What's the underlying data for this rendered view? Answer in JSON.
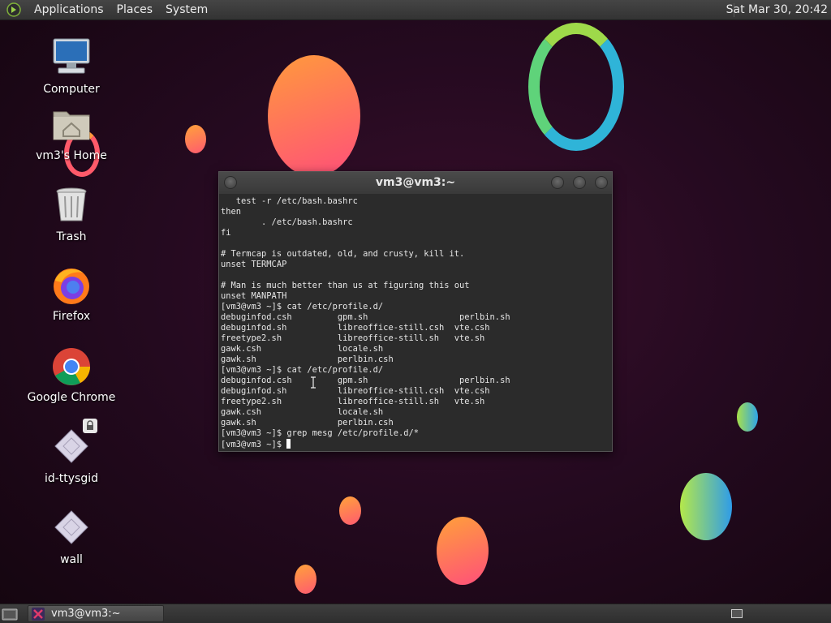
{
  "top_panel": {
    "menus": [
      "Applications",
      "Places",
      "System"
    ],
    "clock": "Sat Mar 30, 20:42"
  },
  "desktop_icons": [
    {
      "label": "Computer",
      "icon": "computer-icon"
    },
    {
      "label": "vm3's Home",
      "icon": "home-folder-icon"
    },
    {
      "label": "Trash",
      "icon": "trash-icon"
    },
    {
      "label": "Firefox",
      "icon": "firefox-icon"
    },
    {
      "label": "Google Chrome",
      "icon": "chrome-icon"
    },
    {
      "label": "id-ttysgid",
      "icon": "script-file-icon"
    },
    {
      "label": "wall",
      "icon": "script-file-icon"
    }
  ],
  "terminal": {
    "title": "vm3@vm3:~",
    "lines": [
      "   test -r /etc/bash.bashrc",
      "then",
      "        . /etc/bash.bashrc",
      "fi",
      "",
      "# Termcap is outdated, old, and crusty, kill it.",
      "unset TERMCAP",
      "",
      "# Man is much better than us at figuring this out",
      "unset MANPATH",
      "[vm3@vm3 ~]$ cat /etc/profile.d/",
      "debuginfod.csh         gpm.sh                  perlbin.sh",
      "debuginfod.sh          libreoffice-still.csh  vte.csh",
      "freetype2.sh           libreoffice-still.sh   vte.sh",
      "gawk.csh               locale.sh",
      "gawk.sh                perlbin.csh",
      "[vm3@vm3 ~]$ cat /etc/profile.d/",
      "debuginfod.csh         gpm.sh                  perlbin.sh",
      "debuginfod.sh          libreoffice-still.csh  vte.csh",
      "freetype2.sh           libreoffice-still.sh   vte.sh",
      "gawk.csh               locale.sh",
      "gawk.sh                perlbin.csh",
      "[vm3@vm3 ~]$ grep mesg /etc/profile.d/*"
    ],
    "prompt": "[vm3@vm3 ~]$ "
  },
  "taskbar": {
    "window_button": "vm3@vm3:~"
  },
  "colors": {
    "panel": "#3a3a3a",
    "desktop_bg": "#250a20",
    "terminal_bg": "#2b2b2b"
  }
}
